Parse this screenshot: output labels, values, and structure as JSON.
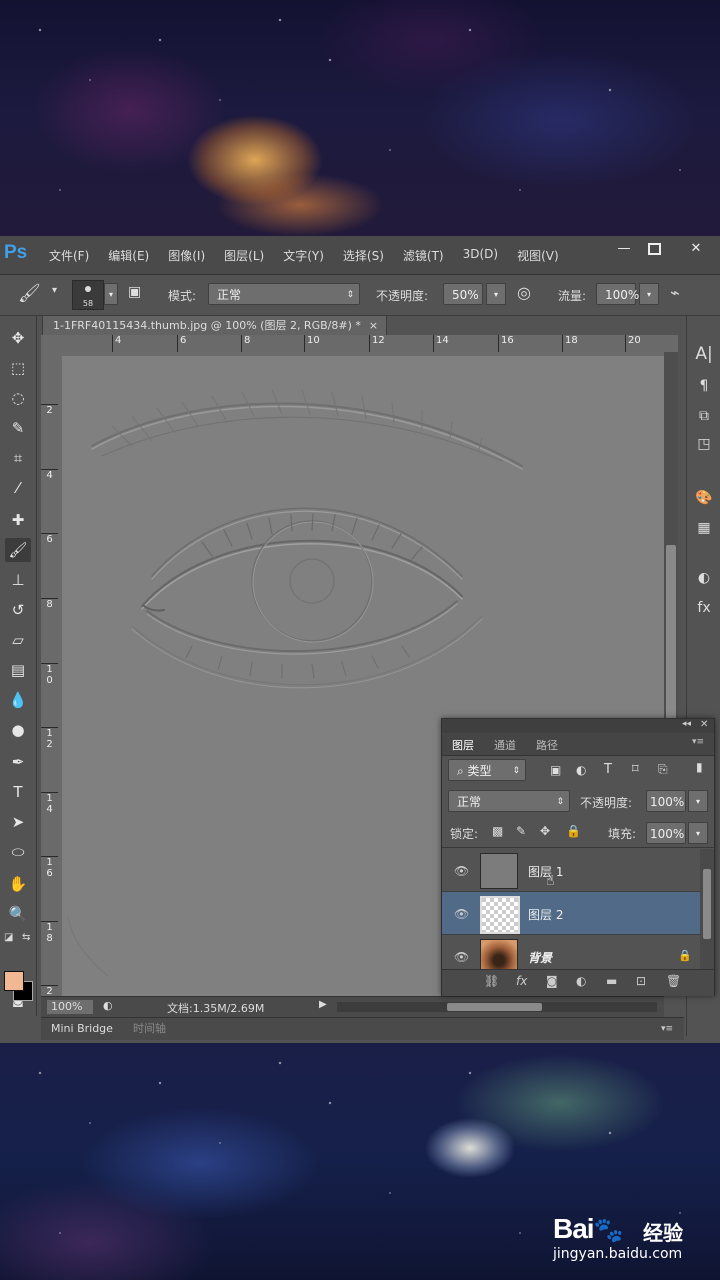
{
  "app": {
    "logo": "Ps",
    "menu": [
      "文件(F)",
      "编辑(E)",
      "图像(I)",
      "图层(L)",
      "文字(Y)",
      "选择(S)",
      "滤镜(T)",
      "3D(D)",
      "视图(V)"
    ],
    "window_controls": {
      "minimize": "—",
      "close": "✕"
    }
  },
  "options": {
    "brush_size": "58",
    "mode_label": "模式:",
    "mode_value": "正常",
    "opacity_label": "不透明度:",
    "opacity_value": "50%",
    "flow_label": "流量:",
    "flow_value": "100%"
  },
  "document": {
    "tab_title": "1-1FRF40115434.thumb.jpg @ 100% (图层 2, RGB/8#) *",
    "tab_close": "×"
  },
  "rulers": {
    "horizontal": [
      "4",
      "6",
      "8",
      "10",
      "12",
      "14",
      "16",
      "18",
      "20"
    ],
    "vertical": [
      "2",
      "4",
      "6",
      "8",
      "1\n0",
      "1\n2",
      "1\n4",
      "1\n6",
      "1\n8",
      "2"
    ]
  },
  "status": {
    "zoom": "100%",
    "doc_info": "文档:1.35M/2.69M"
  },
  "bottom_panel": {
    "tabs": [
      "Mini Bridge",
      "时间轴"
    ]
  },
  "layers_panel": {
    "tabs": [
      "图层",
      "通道",
      "路径"
    ],
    "filter_kind": "类型",
    "blend_mode": "正常",
    "opacity_label": "不透明度:",
    "opacity_value": "100%",
    "lock_label": "锁定:",
    "fill_label": "填充:",
    "fill_value": "100%",
    "layers": [
      {
        "name": "图层 1",
        "selected": false
      },
      {
        "name": "图层 2",
        "selected": true
      },
      {
        "name": "背景",
        "selected": false,
        "locked": true
      }
    ],
    "footer_icons": [
      "link-icon",
      "fx-icon",
      "mask-icon",
      "adjustment-icon",
      "folder-icon",
      "new-layer-icon",
      "trash-icon"
    ]
  },
  "watermark": {
    "logo": "Bai",
    "logo_suffix": "经验",
    "url": "jingyan.baidu.com"
  },
  "colors": {
    "foreground": "#f0b893",
    "background": "#000000",
    "selected_layer": "#506a88",
    "ps_logo": "#3f9fe8"
  }
}
